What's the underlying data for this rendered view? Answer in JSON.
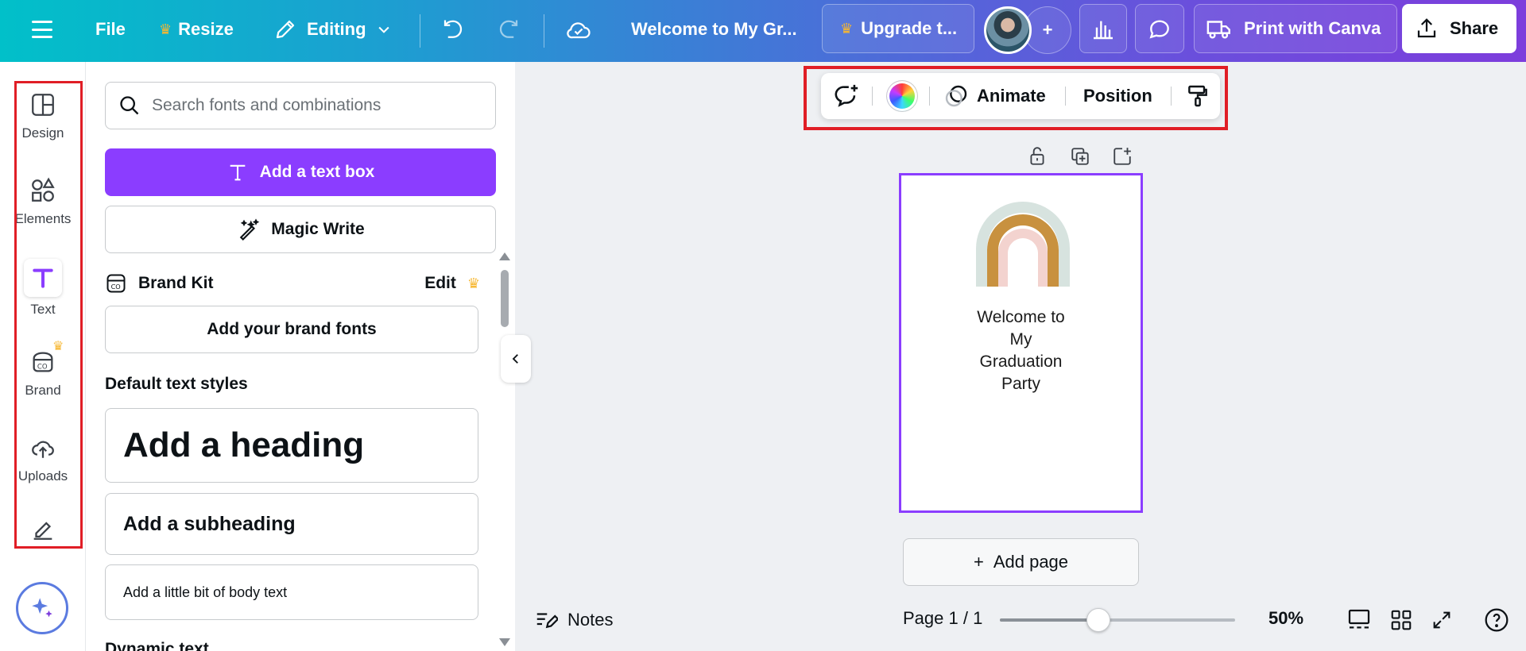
{
  "topbar": {
    "file": "File",
    "resize": "Resize",
    "editing": "Editing",
    "doc_title": "Welcome to My Gr...",
    "upgrade": "Upgrade t...",
    "add_people": "+",
    "print": "Print with Canva",
    "share": "Share"
  },
  "rail": {
    "items": [
      {
        "label": "Design",
        "icon": "layout-icon"
      },
      {
        "label": "Elements",
        "icon": "shapes-icon"
      },
      {
        "label": "Text",
        "icon": "text-icon"
      },
      {
        "label": "Brand",
        "icon": "brand-icon"
      },
      {
        "label": "Uploads",
        "icon": "upload-cloud-icon"
      }
    ]
  },
  "panel": {
    "search_placeholder": "Search fonts and combinations",
    "add_text_box": "Add a text box",
    "magic_write": "Magic Write",
    "brand_kit": "Brand Kit",
    "brand_edit": "Edit",
    "add_brand_fonts": "Add your brand fonts",
    "default_styles_title": "Default text styles",
    "heading": "Add a heading",
    "subheading": "Add a subheading",
    "body": "Add a little bit of body text",
    "dynamic_text": "Dynamic text"
  },
  "context_toolbar": {
    "animate": "Animate",
    "position": "Position"
  },
  "page": {
    "text_lines": [
      "Welcome to",
      "My",
      "Graduation",
      "Party"
    ]
  },
  "canvas": {
    "add_page": "Add page"
  },
  "bottombar": {
    "notes": "Notes",
    "page_info": "Page 1 / 1",
    "zoom": "50%",
    "zoom_fraction": 0.42
  },
  "colors": {
    "accent_purple": "#8b3dff",
    "highlight_red": "#e01e26",
    "crown_gold": "#f7b731"
  }
}
